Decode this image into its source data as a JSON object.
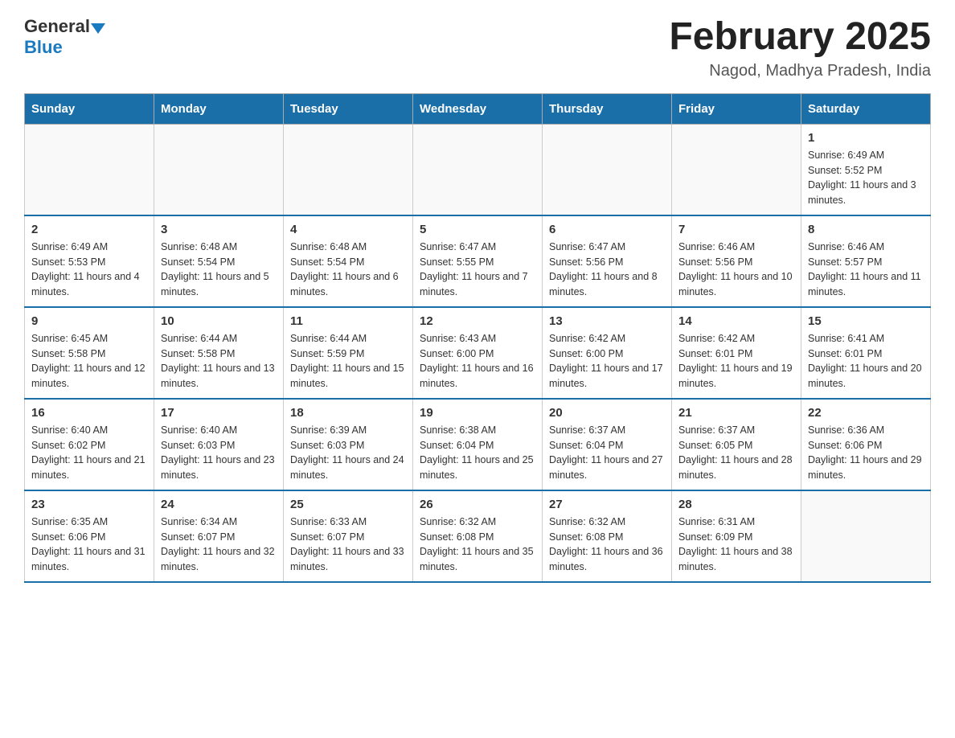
{
  "header": {
    "logo_general": "General",
    "logo_blue": "Blue",
    "month_title": "February 2025",
    "location": "Nagod, Madhya Pradesh, India"
  },
  "weekdays": [
    "Sunday",
    "Monday",
    "Tuesday",
    "Wednesday",
    "Thursday",
    "Friday",
    "Saturday"
  ],
  "weeks": [
    [
      {
        "day": "",
        "info": ""
      },
      {
        "day": "",
        "info": ""
      },
      {
        "day": "",
        "info": ""
      },
      {
        "day": "",
        "info": ""
      },
      {
        "day": "",
        "info": ""
      },
      {
        "day": "",
        "info": ""
      },
      {
        "day": "1",
        "info": "Sunrise: 6:49 AM\nSunset: 5:52 PM\nDaylight: 11 hours and 3 minutes."
      }
    ],
    [
      {
        "day": "2",
        "info": "Sunrise: 6:49 AM\nSunset: 5:53 PM\nDaylight: 11 hours and 4 minutes."
      },
      {
        "day": "3",
        "info": "Sunrise: 6:48 AM\nSunset: 5:54 PM\nDaylight: 11 hours and 5 minutes."
      },
      {
        "day": "4",
        "info": "Sunrise: 6:48 AM\nSunset: 5:54 PM\nDaylight: 11 hours and 6 minutes."
      },
      {
        "day": "5",
        "info": "Sunrise: 6:47 AM\nSunset: 5:55 PM\nDaylight: 11 hours and 7 minutes."
      },
      {
        "day": "6",
        "info": "Sunrise: 6:47 AM\nSunset: 5:56 PM\nDaylight: 11 hours and 8 minutes."
      },
      {
        "day": "7",
        "info": "Sunrise: 6:46 AM\nSunset: 5:56 PM\nDaylight: 11 hours and 10 minutes."
      },
      {
        "day": "8",
        "info": "Sunrise: 6:46 AM\nSunset: 5:57 PM\nDaylight: 11 hours and 11 minutes."
      }
    ],
    [
      {
        "day": "9",
        "info": "Sunrise: 6:45 AM\nSunset: 5:58 PM\nDaylight: 11 hours and 12 minutes."
      },
      {
        "day": "10",
        "info": "Sunrise: 6:44 AM\nSunset: 5:58 PM\nDaylight: 11 hours and 13 minutes."
      },
      {
        "day": "11",
        "info": "Sunrise: 6:44 AM\nSunset: 5:59 PM\nDaylight: 11 hours and 15 minutes."
      },
      {
        "day": "12",
        "info": "Sunrise: 6:43 AM\nSunset: 6:00 PM\nDaylight: 11 hours and 16 minutes."
      },
      {
        "day": "13",
        "info": "Sunrise: 6:42 AM\nSunset: 6:00 PM\nDaylight: 11 hours and 17 minutes."
      },
      {
        "day": "14",
        "info": "Sunrise: 6:42 AM\nSunset: 6:01 PM\nDaylight: 11 hours and 19 minutes."
      },
      {
        "day": "15",
        "info": "Sunrise: 6:41 AM\nSunset: 6:01 PM\nDaylight: 11 hours and 20 minutes."
      }
    ],
    [
      {
        "day": "16",
        "info": "Sunrise: 6:40 AM\nSunset: 6:02 PM\nDaylight: 11 hours and 21 minutes."
      },
      {
        "day": "17",
        "info": "Sunrise: 6:40 AM\nSunset: 6:03 PM\nDaylight: 11 hours and 23 minutes."
      },
      {
        "day": "18",
        "info": "Sunrise: 6:39 AM\nSunset: 6:03 PM\nDaylight: 11 hours and 24 minutes."
      },
      {
        "day": "19",
        "info": "Sunrise: 6:38 AM\nSunset: 6:04 PM\nDaylight: 11 hours and 25 minutes."
      },
      {
        "day": "20",
        "info": "Sunrise: 6:37 AM\nSunset: 6:04 PM\nDaylight: 11 hours and 27 minutes."
      },
      {
        "day": "21",
        "info": "Sunrise: 6:37 AM\nSunset: 6:05 PM\nDaylight: 11 hours and 28 minutes."
      },
      {
        "day": "22",
        "info": "Sunrise: 6:36 AM\nSunset: 6:06 PM\nDaylight: 11 hours and 29 minutes."
      }
    ],
    [
      {
        "day": "23",
        "info": "Sunrise: 6:35 AM\nSunset: 6:06 PM\nDaylight: 11 hours and 31 minutes."
      },
      {
        "day": "24",
        "info": "Sunrise: 6:34 AM\nSunset: 6:07 PM\nDaylight: 11 hours and 32 minutes."
      },
      {
        "day": "25",
        "info": "Sunrise: 6:33 AM\nSunset: 6:07 PM\nDaylight: 11 hours and 33 minutes."
      },
      {
        "day": "26",
        "info": "Sunrise: 6:32 AM\nSunset: 6:08 PM\nDaylight: 11 hours and 35 minutes."
      },
      {
        "day": "27",
        "info": "Sunrise: 6:32 AM\nSunset: 6:08 PM\nDaylight: 11 hours and 36 minutes."
      },
      {
        "day": "28",
        "info": "Sunrise: 6:31 AM\nSunset: 6:09 PM\nDaylight: 11 hours and 38 minutes."
      },
      {
        "day": "",
        "info": ""
      }
    ]
  ]
}
